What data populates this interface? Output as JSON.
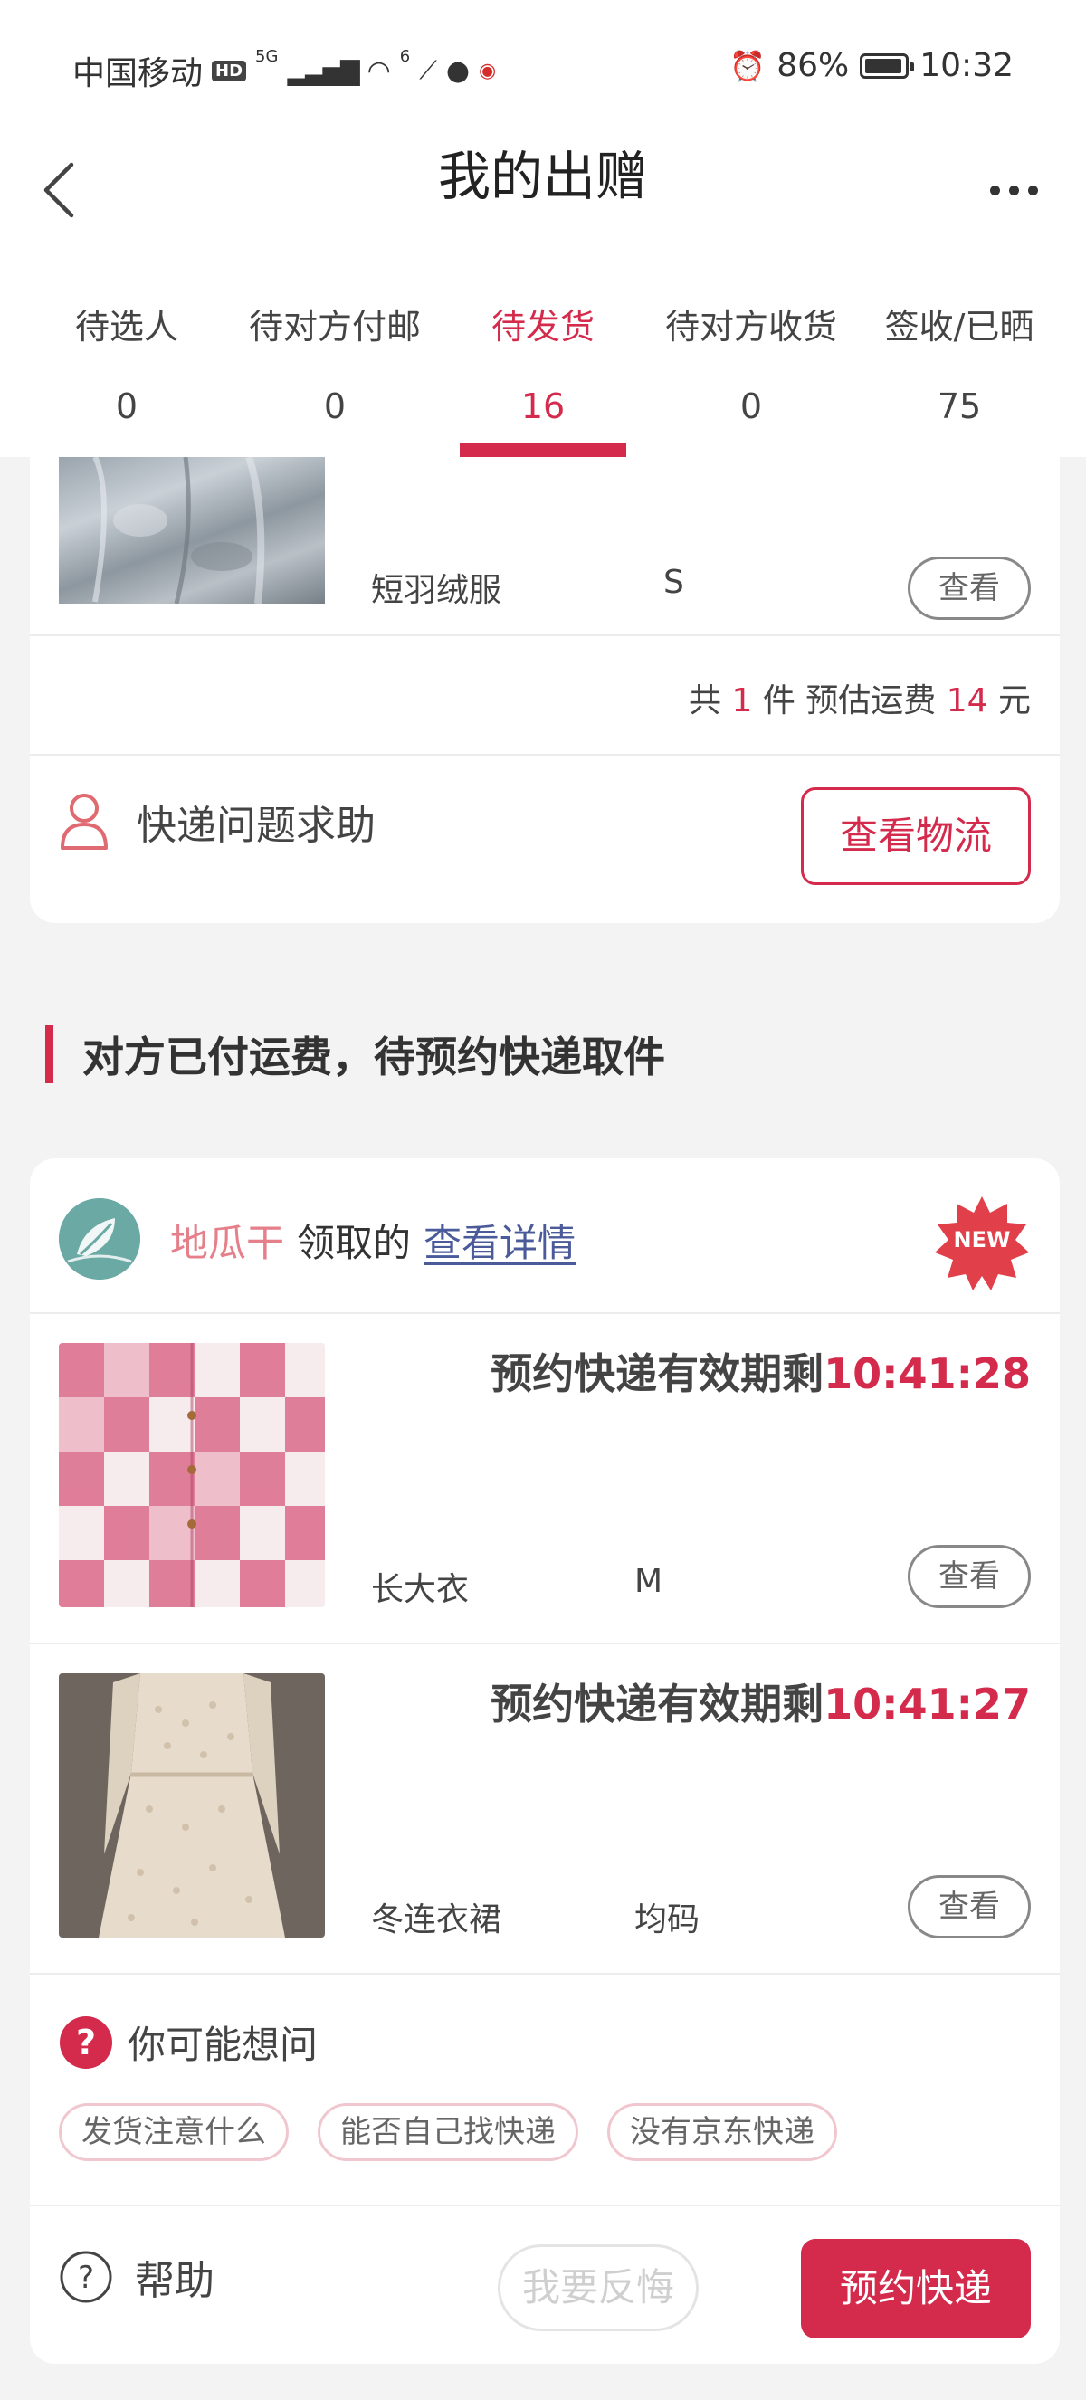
{
  "status_bar": {
    "carrier": "中国移动",
    "hd": "HD",
    "network": "5G",
    "wifi_index": "6",
    "alarm_icon": "alarm-icon",
    "battery_percent": "86%",
    "time": "10:32"
  },
  "nav": {
    "title": "我的出赠"
  },
  "tabs": [
    {
      "label": "待选人",
      "count": "0"
    },
    {
      "label": "待对方付邮",
      "count": "0"
    },
    {
      "label": "待发货",
      "count": "16"
    },
    {
      "label": "待对方收货",
      "count": "0"
    },
    {
      "label": "签收/已晒",
      "count": "75"
    }
  ],
  "order1": {
    "item": {
      "name": "短羽绒服",
      "size": "S",
      "view_label": "查看"
    },
    "summary": {
      "prefix": "共",
      "count": "1",
      "mid": "件 预估运费",
      "fee": "14",
      "unit": "元"
    },
    "help_label": "快递问题求助",
    "logistics_label": "查看物流"
  },
  "section": {
    "title": "对方已付运费，待预约快递取件"
  },
  "order2": {
    "receiver": "地瓜干",
    "claimed_text": "领取的",
    "detail_link": "查看详情",
    "new_badge": "NEW",
    "items": [
      {
        "countdown_label": "预约快递有效期剩",
        "countdown": "10:41:28",
        "name": "长大衣",
        "size": "M",
        "view_label": "查看"
      },
      {
        "countdown_label": "预约快递有效期剩",
        "countdown": "10:41:27",
        "name": "冬连衣裙",
        "size": "均码",
        "view_label": "查看"
      }
    ],
    "faq": {
      "title": "你可能想问",
      "chips": [
        "发货注意什么",
        "能否自己找快递",
        "没有京东快递"
      ]
    },
    "footer": {
      "help_label": "帮助",
      "regret_label": "我要反悔",
      "book_label": "预约快递"
    }
  },
  "colors": {
    "accent": "#d42b4d",
    "receiver_name": "#e57f8a",
    "link": "#4b5b9a",
    "background": "#f3f3f3"
  }
}
